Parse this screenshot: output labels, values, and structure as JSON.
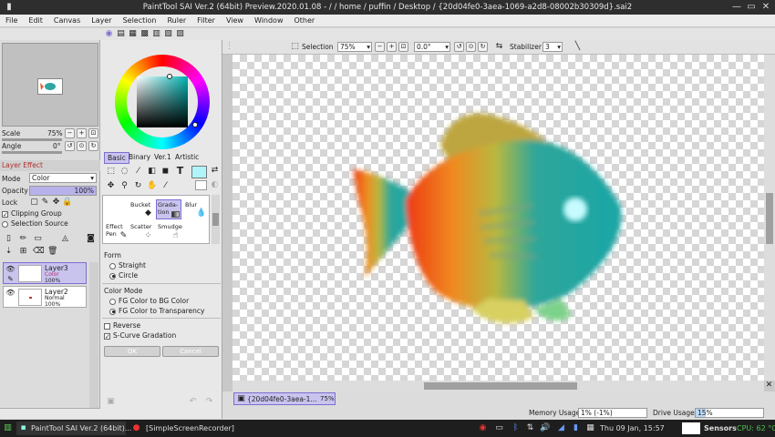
{
  "window": {
    "title": "PaintTool SAI Ver.2 (64bit) Preview.2020.01.08 - / / home / puffin / Desktop / {20d04fe0-3aea-1069-a2d8-08002b30309d}.sai2"
  },
  "menu": [
    "File",
    "Edit",
    "Canvas",
    "Layer",
    "Selection",
    "Ruler",
    "Filter",
    "View",
    "Window",
    "Other"
  ],
  "navigator": {
    "scale_label": "Scale",
    "scale_value": "75%",
    "angle_label": "Angle",
    "angle_value": "0°"
  },
  "layer_effect": {
    "header": "Layer Effect",
    "mode_label": "Mode",
    "mode_value": "Color",
    "opacity_label": "Opacity",
    "opacity_value": "100%",
    "lock_label": "Lock",
    "clipping_group": "Clipping Group",
    "selection_source": "Selection Source"
  },
  "layers": [
    {
      "name": "Layer3",
      "mode": "Color",
      "opacity": "100%",
      "active": true
    },
    {
      "name": "Layer2",
      "mode": "Normal",
      "opacity": "100%",
      "active": false
    }
  ],
  "color_tabs": [
    "Basic",
    "Binary",
    "Ver.1",
    "Artistic"
  ],
  "colors": {
    "current": "#aef4f8",
    "accent": "#7a6fd0",
    "wheel_square": "#157a78"
  },
  "tools": {
    "row1": [
      "Bucket",
      "Grada-tion",
      "Blur"
    ],
    "row2": [
      "Effect Pen",
      "Scatter",
      "Smudge"
    ]
  },
  "gradation": {
    "form_label": "Form",
    "form_options": [
      "Straight",
      "Circle"
    ],
    "form_selected": "Circle",
    "color_mode_label": "Color Mode",
    "color_mode_options": [
      "FG Color to BG Color",
      "FG Color to Transparency"
    ],
    "color_mode_selected": "FG Color to Transparency",
    "reverse": "Reverse",
    "s_curve": "S-Curve Gradation",
    "ok": "OK",
    "cancel": "Cancel"
  },
  "toolbar": {
    "selection_label": "Selection",
    "zoom": "75%",
    "angle": "0.0°",
    "stabilizer_label": "Stabilizer",
    "stabilizer_value": "3"
  },
  "document_tab": {
    "name": "{20d04fe0-3aea-1...",
    "zoom": "75%"
  },
  "status": {
    "memory_label": "Memory Usage",
    "memory_value": "1% (-1%)",
    "drive_label": "Drive Usage",
    "drive_value": "15%"
  },
  "taskbar": {
    "task1": "PaintTool SAI Ver.2 (64bit)...",
    "task2": "[SimpleScreenRecorder]",
    "clock": "Thu 09 Jan, 15:57",
    "sensors_label": "Sensors",
    "cpu": "CPU: 62 °C"
  }
}
